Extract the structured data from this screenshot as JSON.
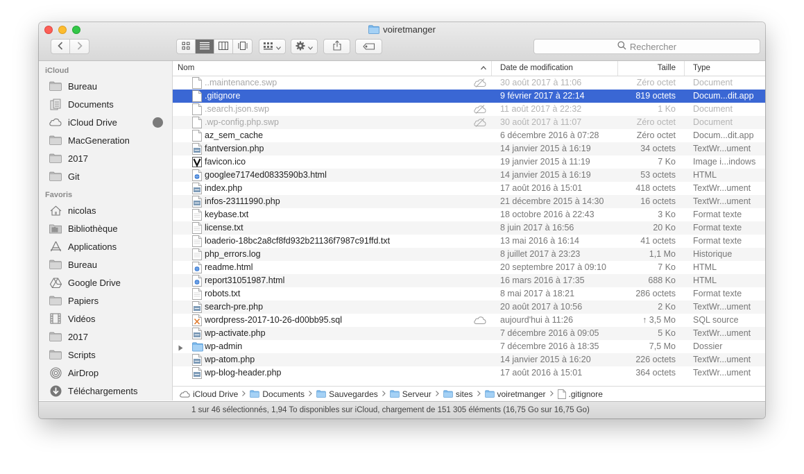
{
  "window": {
    "title": "voiretmanger"
  },
  "toolbar": {
    "search_placeholder": "Rechercher"
  },
  "sidebar": {
    "sections": [
      {
        "header": "iCloud",
        "items": [
          {
            "label": "Bureau",
            "icon": "folder-icon"
          },
          {
            "label": "Documents",
            "icon": "documents-icon"
          },
          {
            "label": "iCloud Drive",
            "icon": "cloud-icon"
          },
          {
            "label": "MacGeneration",
            "icon": "folder-icon"
          },
          {
            "label": "2017",
            "icon": "folder-icon"
          },
          {
            "label": "Git",
            "icon": "folder-icon"
          }
        ]
      },
      {
        "header": "Favoris",
        "items": [
          {
            "label": "nicolas",
            "icon": "home-icon"
          },
          {
            "label": "Bibliothèque",
            "icon": "library-icon"
          },
          {
            "label": "Applications",
            "icon": "applications-icon"
          },
          {
            "label": "Bureau",
            "icon": "folder-icon"
          },
          {
            "label": "Google Drive",
            "icon": "google-drive-icon"
          },
          {
            "label": "Papiers",
            "icon": "folder-icon"
          },
          {
            "label": "Vidéos",
            "icon": "film-icon"
          },
          {
            "label": "2017",
            "icon": "folder-icon"
          },
          {
            "label": "Scripts",
            "icon": "folder-icon"
          },
          {
            "label": "AirDrop",
            "icon": "airdrop-icon"
          },
          {
            "label": "Téléchargements",
            "icon": "download-icon"
          }
        ]
      }
    ]
  },
  "columns": {
    "name": "Nom",
    "date": "Date de modification",
    "size": "Taille",
    "kind": "Type"
  },
  "files": [
    {
      "name": "..maintenance.swp",
      "date": "30 août 2017 à 11:06",
      "size": "Zéro octet",
      "kind": "Document",
      "icon": "doc",
      "dim": true,
      "badge": "nocloud"
    },
    {
      "name": ".gitignore",
      "date": "9 février 2017 à 22:14",
      "size": "819 octets",
      "kind": "Docum...dit.app",
      "icon": "doc",
      "selected": true
    },
    {
      "name": ".search.json.swp",
      "date": "11 août 2017 à 22:32",
      "size": "1 Ko",
      "kind": "Document",
      "icon": "doc",
      "dim": true,
      "badge": "nocloud"
    },
    {
      "name": ".wp-config.php.swp",
      "date": "30 août 2017 à 11:07",
      "size": "Zéro octet",
      "kind": "Document",
      "icon": "doc",
      "dim": true,
      "badge": "nocloud"
    },
    {
      "name": "az_sem_cache",
      "date": "6 décembre 2016 à 07:28",
      "size": "Zéro octet",
      "kind": "Docum...dit.app",
      "icon": "doc"
    },
    {
      "name": "fantversion.php",
      "date": "14 janvier 2015 à 16:19",
      "size": "34 octets",
      "kind": "TextWr...ument",
      "icon": "php"
    },
    {
      "name": "favicon.ico",
      "date": "19 janvier 2015 à 11:19",
      "size": "7 Ko",
      "kind": "Image i...indows",
      "icon": "ico"
    },
    {
      "name": "googlee7174ed0833590b3.html",
      "date": "14 janvier 2015 à 16:19",
      "size": "53 octets",
      "kind": "HTML",
      "icon": "html"
    },
    {
      "name": "index.php",
      "date": "17 août 2016 à 15:01",
      "size": "418 octets",
      "kind": "TextWr...ument",
      "icon": "php"
    },
    {
      "name": "infos-23111990.php",
      "date": "21 décembre 2015 à 14:30",
      "size": "16 octets",
      "kind": "TextWr...ument",
      "icon": "php"
    },
    {
      "name": "keybase.txt",
      "date": "18 octobre 2016 à 22:43",
      "size": "3 Ko",
      "kind": "Format texte",
      "icon": "txt"
    },
    {
      "name": "license.txt",
      "date": "8 juin 2017 à 16:56",
      "size": "20 Ko",
      "kind": "Format texte",
      "icon": "txt"
    },
    {
      "name": "loaderio-18bc2a8cf8fd932b21136f7987c91ffd.txt",
      "date": "13 mai 2016 à 16:14",
      "size": "41 octets",
      "kind": "Format texte",
      "icon": "txt"
    },
    {
      "name": "php_errors.log",
      "date": "8 juillet 2017 à 23:23",
      "size": "1,1 Mo",
      "kind": "Historique",
      "icon": "txt"
    },
    {
      "name": "readme.html",
      "date": "20 septembre 2017 à 09:10",
      "size": "7 Ko",
      "kind": "HTML",
      "icon": "html"
    },
    {
      "name": "report31051987.html",
      "date": "16 mars 2016 à 17:35",
      "size": "688 Ko",
      "kind": "HTML",
      "icon": "html"
    },
    {
      "name": "robots.txt",
      "date": "8 mai 2017 à 18:21",
      "size": "286 octets",
      "kind": "Format texte",
      "icon": "txt"
    },
    {
      "name": "search-pre.php",
      "date": "20 août 2017 à 10:56",
      "size": "2 Ko",
      "kind": "TextWr...ument",
      "icon": "php"
    },
    {
      "name": "wordpress-2017-10-26-d00bb95.sql",
      "date": "aujourd'hui à 11:26",
      "size": "↑ 3,5 Mo",
      "kind": "SQL source",
      "icon": "sql",
      "badge": "cloud"
    },
    {
      "name": "wp-activate.php",
      "date": "7 décembre 2016 à 09:05",
      "size": "5 Ko",
      "kind": "TextWr...ument",
      "icon": "php"
    },
    {
      "name": "wp-admin",
      "date": "7 décembre 2016 à 18:35",
      "size": "7,5 Mo",
      "kind": "Dossier",
      "icon": "folder",
      "folder": true
    },
    {
      "name": "wp-atom.php",
      "date": "14 janvier 2015 à 16:20",
      "size": "226 octets",
      "kind": "TextWr...ument",
      "icon": "php"
    },
    {
      "name": "wp-blog-header.php",
      "date": "17 août 2016 à 15:01",
      "size": "364 octets",
      "kind": "TextWr...ument",
      "icon": "php"
    }
  ],
  "pathbar": [
    {
      "label": "iCloud Drive",
      "icon": "cloud-icon"
    },
    {
      "label": "Documents",
      "icon": "folder-icon"
    },
    {
      "label": "Sauvegardes",
      "icon": "folder-icon"
    },
    {
      "label": "Serveur",
      "icon": "folder-icon"
    },
    {
      "label": "sites",
      "icon": "folder-icon"
    },
    {
      "label": "voiretmanger",
      "icon": "folder-icon"
    },
    {
      "label": ".gitignore",
      "icon": "doc-icon"
    }
  ],
  "status": "1 sur 46 sélectionnés, 1,94 To disponibles sur iCloud, chargement de 151 305 éléments (16,75 Go sur 16,75 Go)"
}
